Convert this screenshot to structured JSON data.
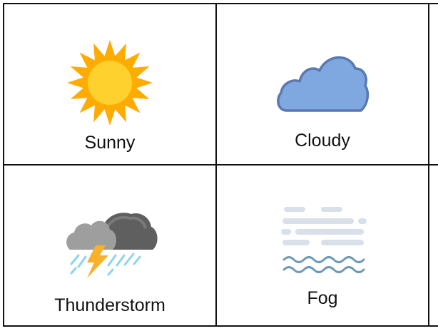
{
  "weather_grid": {
    "cells": [
      {
        "label": "Sunny",
        "icon": "sun-icon"
      },
      {
        "label": "Cloudy",
        "icon": "cloud-icon"
      },
      {
        "label": "Thunderstorm",
        "icon": "thunderstorm-icon"
      },
      {
        "label": "Fog",
        "icon": "fog-icon"
      }
    ]
  },
  "colors": {
    "grid_line": "#111111",
    "sun_rays": "#ffab00",
    "sun_core": "#ffd12e",
    "cloud_fill": "#7ea8df",
    "cloud_outline": "#5a79b3",
    "storm_cloud_dark": "#5f5f5f",
    "storm_cloud_light": "#9e9e9e",
    "lightning": "#f9b02a",
    "rain": "#8fd3f2",
    "fog_bars": "#d9e0ea",
    "fog_waves": "#6e9ab4"
  }
}
